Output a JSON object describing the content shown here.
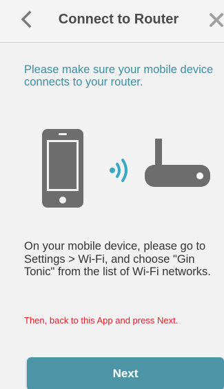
{
  "header": {
    "title": "Connect to Router",
    "back_icon": "chevron-left-icon",
    "close_icon": "close-icon"
  },
  "main": {
    "intro": "Please make sure your mobile device connects to your router.",
    "illustration": {
      "phone_icon": "smartphone-icon",
      "signal_icon": "wifi-signal-icon",
      "router_icon": "router-icon"
    },
    "instruction": "On your mobile device, please go to Settings > Wi-Fi, and choose \"Gin Tonic\" from the list of Wi-Fi networks.",
    "note": "Then, back to this App and press Next.",
    "next_label": "Next"
  },
  "colors": {
    "accent": "#4b95a7",
    "intro_text": "#3a8ea6",
    "warning": "#e02020",
    "icon_gray": "#6d6d6d"
  }
}
